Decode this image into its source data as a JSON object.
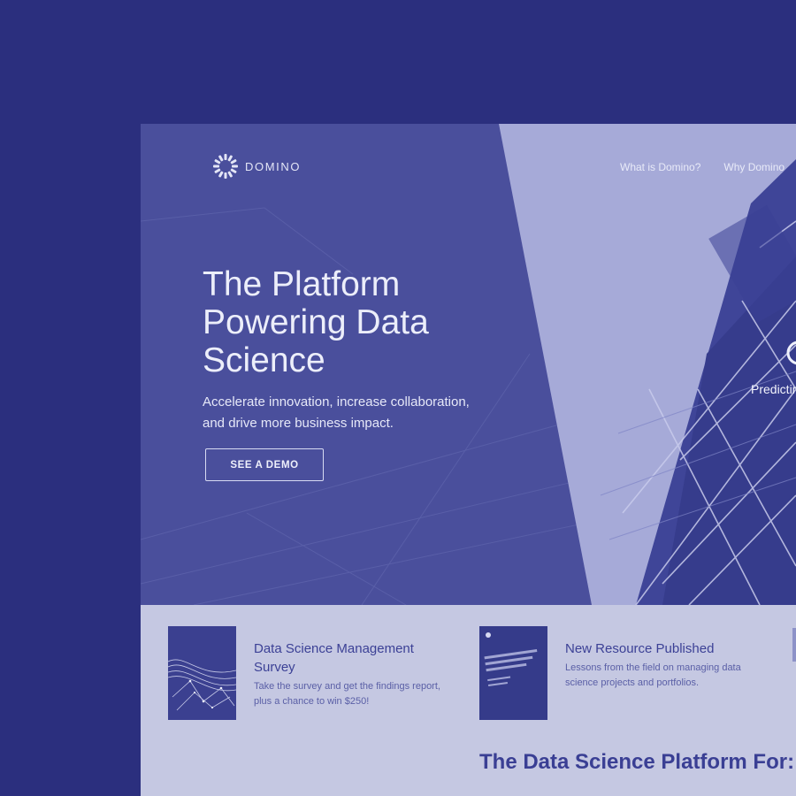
{
  "colors": {
    "outer_background": "#2b2f7e",
    "hero_overlay": "#4a4f9c",
    "content_background": "#c5c8e2",
    "accent_text": "#3c4196"
  },
  "header": {
    "logo_icon": "domino-ring-icon",
    "logo_text": "DOMINO",
    "nav": [
      "What is Domino?",
      "Why Domino"
    ]
  },
  "hero": {
    "title": "The Platform Powering Data Science",
    "subtitle": "Accelerate innovation, increase collaboration, and drive more business impact.",
    "cta_label": "SEE A DEMO",
    "side_label": "Predictin"
  },
  "cards": [
    {
      "title": "Data Science Management Survey",
      "description": "Take the survey and get the findings report, plus a chance to win $250!",
      "thumb_icon": "network-wave-icon"
    },
    {
      "title": "New Resource Published",
      "description": "Lessons from the field on managing data science projects and portfolios.",
      "thumb_icon": "book-cover-icon"
    }
  ],
  "section_heading": "The Data Science Platform For:"
}
